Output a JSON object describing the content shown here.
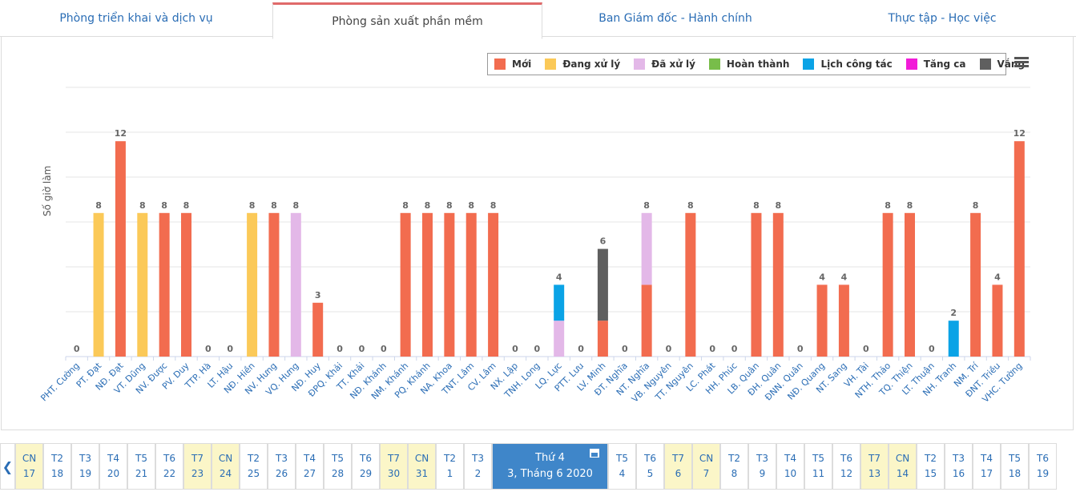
{
  "tabs": [
    {
      "label": "Phòng triển khai và dịch vụ",
      "active": false
    },
    {
      "label": "Phòng sản xuất phần mềm",
      "active": true
    },
    {
      "label": "Ban Giám đốc - Hành chính",
      "active": false
    },
    {
      "label": "Thực tập - Học việc",
      "active": false
    }
  ],
  "legend": [
    {
      "label": "Mới",
      "color": "#f26c4f"
    },
    {
      "label": "Đang xử lý",
      "color": "#fbc958"
    },
    {
      "label": "Đã xử lý",
      "color": "#e3b8e8"
    },
    {
      "label": "Hoàn thành",
      "color": "#78bd4a"
    },
    {
      "label": "Lịch công tác",
      "color": "#0aa3e6"
    },
    {
      "label": "Tăng ca",
      "color": "#f21bd8"
    },
    {
      "label": "Vắng",
      "color": "#5f5f5f"
    }
  ],
  "menu_icon": "hamburger-menu-icon",
  "chart_data": {
    "type": "bar",
    "stacked": true,
    "ylabel": "Số giờ làm",
    "ylim": [
      0,
      15
    ],
    "grid": true,
    "legend_position": "top-right",
    "categories": [
      "PHT. Cường",
      "PT. Đạt",
      "NĐ. Đạt",
      "VT. Dũng",
      "NV. Được",
      "PV. Duy",
      "TTP. Hà",
      "LT. Hậu",
      "NĐ. Hiền",
      "NV. Hưng",
      "VQ. Hưng",
      "NĐ. Huy",
      "ĐPQ. Khải",
      "TT. Khải",
      "NĐ. Khánh",
      "NM. Khánh",
      "PQ. Khánh",
      "NA. Khoa",
      "TNT. Lâm",
      "CV. Lâm",
      "NX. Lập",
      "TNH. Long",
      "LQ. Lực",
      "PTT. Lưu",
      "LV. Minh",
      "ĐT. Nghĩa",
      "NT. Nghĩa",
      "VB. Nguyên",
      "TT. Nguyên",
      "LC. Phát",
      "HH. Phúc",
      "LB. Quân",
      "ĐH. Quân",
      "ĐNN. Quân",
      "NĐ. Quang",
      "NT. Sang",
      "VH. Tài",
      "NTH. Thảo",
      "TQ. Thiện",
      "LT. Thuận",
      "NH. Tranh",
      "NM. Trí",
      "ĐNT. Triều",
      "VHC. Tường"
    ],
    "totals": [
      0,
      8,
      12,
      8,
      8,
      8,
      0,
      0,
      8,
      8,
      8,
      3,
      0,
      0,
      0,
      8,
      8,
      8,
      8,
      8,
      0,
      0,
      4,
      0,
      6,
      0,
      8,
      0,
      8,
      0,
      0,
      8,
      8,
      0,
      4,
      4,
      0,
      8,
      8,
      0,
      2,
      8,
      4,
      12
    ],
    "series": [
      {
        "name": "Mới",
        "color": "#f26c4f",
        "values": [
          0,
          0,
          12,
          0,
          8,
          8,
          0,
          0,
          0,
          8,
          0,
          3,
          0,
          0,
          0,
          8,
          8,
          8,
          8,
          8,
          0,
          0,
          0,
          0,
          2,
          0,
          4,
          0,
          8,
          0,
          0,
          8,
          8,
          0,
          4,
          4,
          0,
          8,
          8,
          0,
          0,
          8,
          4,
          12
        ]
      },
      {
        "name": "Đang xử lý",
        "color": "#fbc958",
        "values": [
          0,
          8,
          0,
          8,
          0,
          0,
          0,
          0,
          8,
          0,
          0,
          0,
          0,
          0,
          0,
          0,
          0,
          0,
          0,
          0,
          0,
          0,
          0,
          0,
          0,
          0,
          0,
          0,
          0,
          0,
          0,
          0,
          0,
          0,
          0,
          0,
          0,
          0,
          0,
          0,
          0,
          0,
          0,
          0
        ]
      },
      {
        "name": "Đã xử lý",
        "color": "#e3b8e8",
        "values": [
          0,
          0,
          0,
          0,
          0,
          0,
          0,
          0,
          0,
          0,
          8,
          0,
          0,
          0,
          0,
          0,
          0,
          0,
          0,
          0,
          0,
          0,
          2,
          0,
          0,
          0,
          4,
          0,
          0,
          0,
          0,
          0,
          0,
          0,
          0,
          0,
          0,
          0,
          0,
          0,
          0,
          0,
          0,
          0
        ]
      },
      {
        "name": "Hoàn thành",
        "color": "#78bd4a",
        "values": [
          0,
          0,
          0,
          0,
          0,
          0,
          0,
          0,
          0,
          0,
          0,
          0,
          0,
          0,
          0,
          0,
          0,
          0,
          0,
          0,
          0,
          0,
          0,
          0,
          0,
          0,
          0,
          0,
          0,
          0,
          0,
          0,
          0,
          0,
          0,
          0,
          0,
          0,
          0,
          0,
          0,
          0,
          0,
          0
        ]
      },
      {
        "name": "Lịch công tác",
        "color": "#0aa3e6",
        "values": [
          0,
          0,
          0,
          0,
          0,
          0,
          0,
          0,
          0,
          0,
          0,
          0,
          0,
          0,
          0,
          0,
          0,
          0,
          0,
          0,
          0,
          0,
          2,
          0,
          0,
          0,
          0,
          0,
          0,
          0,
          0,
          0,
          0,
          0,
          0,
          0,
          0,
          0,
          0,
          0,
          2,
          0,
          0,
          0
        ]
      },
      {
        "name": "Tăng ca",
        "color": "#f21bd8",
        "values": [
          0,
          0,
          0,
          0,
          0,
          0,
          0,
          0,
          0,
          0,
          0,
          0,
          0,
          0,
          0,
          0,
          0,
          0,
          0,
          0,
          0,
          0,
          0,
          0,
          0,
          0,
          0,
          0,
          0,
          0,
          0,
          0,
          0,
          0,
          0,
          0,
          0,
          0,
          0,
          0,
          0,
          0,
          0,
          0
        ]
      },
      {
        "name": "Vắng",
        "color": "#5f5f5f",
        "values": [
          0,
          0,
          0,
          0,
          0,
          0,
          0,
          0,
          0,
          0,
          0,
          0,
          0,
          0,
          0,
          0,
          0,
          0,
          0,
          0,
          0,
          0,
          0,
          0,
          4,
          0,
          0,
          0,
          0,
          0,
          0,
          0,
          0,
          0,
          0,
          0,
          0,
          0,
          0,
          0,
          0,
          0,
          0,
          0
        ]
      }
    ]
  },
  "date_nav": {
    "prev_icon": "chevron-left-icon",
    "calendar_icon": "calendar-icon",
    "days_before": [
      {
        "dow": "CN",
        "day": "17",
        "weekend": true
      },
      {
        "dow": "T2",
        "day": "18",
        "weekend": false
      },
      {
        "dow": "T3",
        "day": "19",
        "weekend": false
      },
      {
        "dow": "T4",
        "day": "20",
        "weekend": false
      },
      {
        "dow": "T5",
        "day": "21",
        "weekend": false
      },
      {
        "dow": "T6",
        "day": "22",
        "weekend": false
      },
      {
        "dow": "T7",
        "day": "23",
        "weekend": true
      },
      {
        "dow": "CN",
        "day": "24",
        "weekend": true
      },
      {
        "dow": "T2",
        "day": "25",
        "weekend": false
      },
      {
        "dow": "T3",
        "day": "26",
        "weekend": false
      },
      {
        "dow": "T4",
        "day": "27",
        "weekend": false
      },
      {
        "dow": "T5",
        "day": "28",
        "weekend": false
      },
      {
        "dow": "T6",
        "day": "29",
        "weekend": false
      },
      {
        "dow": "T7",
        "day": "30",
        "weekend": true
      },
      {
        "dow": "CN",
        "day": "31",
        "weekend": true
      },
      {
        "dow": "T2",
        "day": "1",
        "weekend": false
      },
      {
        "dow": "T3",
        "day": "2",
        "weekend": false
      }
    ],
    "selected": {
      "line1": "Thứ 4",
      "line2": "3, Tháng 6 2020"
    },
    "days_after": [
      {
        "dow": "T5",
        "day": "4",
        "weekend": false
      },
      {
        "dow": "T6",
        "day": "5",
        "weekend": false
      },
      {
        "dow": "T7",
        "day": "6",
        "weekend": true
      },
      {
        "dow": "CN",
        "day": "7",
        "weekend": true
      },
      {
        "dow": "T2",
        "day": "8",
        "weekend": false
      },
      {
        "dow": "T3",
        "day": "9",
        "weekend": false
      },
      {
        "dow": "T4",
        "day": "10",
        "weekend": false
      },
      {
        "dow": "T5",
        "day": "11",
        "weekend": false
      },
      {
        "dow": "T6",
        "day": "12",
        "weekend": false
      },
      {
        "dow": "T7",
        "day": "13",
        "weekend": true
      },
      {
        "dow": "CN",
        "day": "14",
        "weekend": true
      },
      {
        "dow": "T2",
        "day": "15",
        "weekend": false
      },
      {
        "dow": "T3",
        "day": "16",
        "weekend": false
      },
      {
        "dow": "T4",
        "day": "17",
        "weekend": false
      },
      {
        "dow": "T5",
        "day": "18",
        "weekend": false
      },
      {
        "dow": "T6",
        "day": "19",
        "weekend": false
      }
    ]
  }
}
